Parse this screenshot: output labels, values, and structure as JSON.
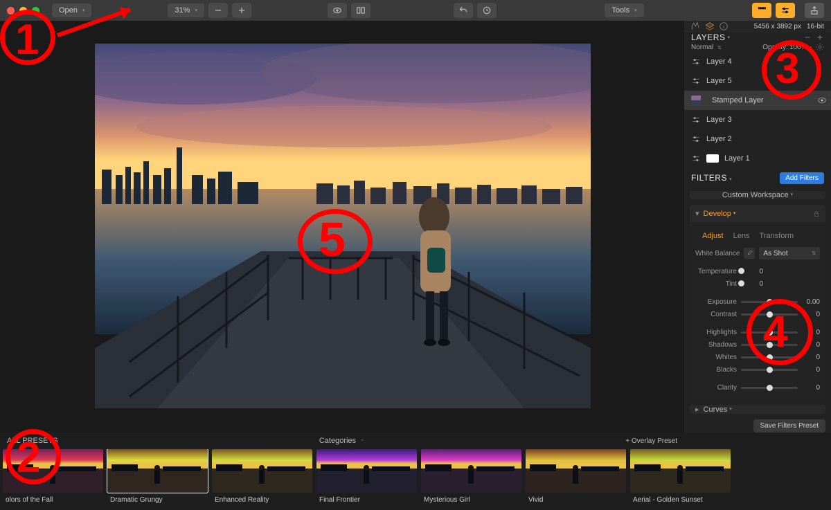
{
  "toolbar": {
    "open_label": "Open",
    "zoom_label": "31%",
    "tools_label": "Tools"
  },
  "image_info": {
    "dimensions": "5456 x 3892 px",
    "bit_depth": "16-bit"
  },
  "layers_panel": {
    "title": "LAYERS",
    "blend_mode": "Normal",
    "opacity_label": "Opacity:",
    "opacity_value": "100%",
    "layers": [
      {
        "name": "Layer 4",
        "icon": "sliders"
      },
      {
        "name": "Layer 5",
        "icon": "sliders"
      },
      {
        "name": "Stamped Layer",
        "icon": "thumb",
        "selected": true
      },
      {
        "name": "Layer 3",
        "icon": "sliders"
      },
      {
        "name": "Layer 2",
        "icon": "sliders"
      },
      {
        "name": "Layer 1",
        "icon": "mask"
      }
    ]
  },
  "filters_panel": {
    "title": "FILTERS",
    "add_label": "Add Filters",
    "workspace_label": "Custom Workspace"
  },
  "develop": {
    "title": "Develop",
    "tabs": {
      "adjust": "Adjust",
      "lens": "Lens",
      "transform": "Transform"
    },
    "white_balance_label": "White Balance",
    "white_balance_value": "As Shot",
    "sliders_block1": [
      {
        "label": "Temperature",
        "value": "0"
      },
      {
        "label": "Tint",
        "value": "0"
      }
    ],
    "sliders_block2": [
      {
        "label": "Exposure",
        "value": "0.00"
      },
      {
        "label": "Contrast",
        "value": "0"
      }
    ],
    "sliders_block3": [
      {
        "label": "Highlights",
        "value": "0"
      },
      {
        "label": "Shadows",
        "value": "0"
      },
      {
        "label": "Whites",
        "value": "0"
      },
      {
        "label": "Blacks",
        "value": "0"
      }
    ],
    "sliders_block4": [
      {
        "label": "Clarity",
        "value": "0"
      }
    ]
  },
  "curves": {
    "title": "Curves"
  },
  "save_preset_label": "Save Filters Preset",
  "presets_bar": {
    "title": "ALL PRESETS",
    "categories_label": "Categories",
    "overlay_label": "+ Overlay Preset",
    "presets": [
      {
        "label": "olors of the Fall",
        "hue": 320
      },
      {
        "label": "Dramatic Grungy",
        "hue": 30,
        "selected": true
      },
      {
        "label": "Enhanced Reality",
        "hue": 35
      },
      {
        "label": "Final Frontier",
        "hue": 255
      },
      {
        "label": "Mysterious Girl",
        "hue": 280
      },
      {
        "label": "Vivid",
        "hue": 20
      },
      {
        "label": "Aerial - Golden Sunset",
        "hue": 40
      }
    ]
  },
  "annotations": {
    "n1": "1",
    "n2": "2",
    "n3": "3",
    "n4": "4",
    "n5": "5"
  }
}
